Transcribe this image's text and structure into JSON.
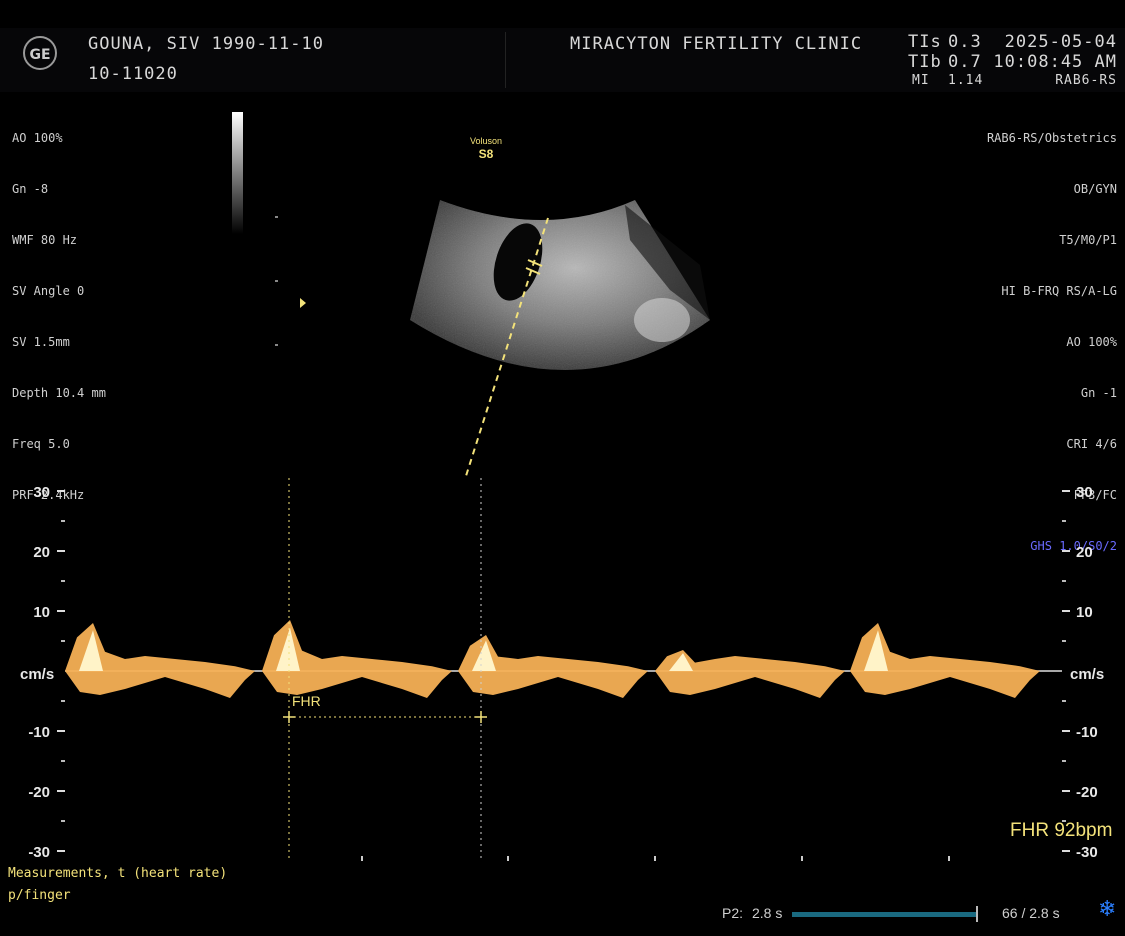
{
  "header": {
    "logo": "GE",
    "patient_name": "GOUNA, SIV  1990-11-10",
    "patient_id": "10-11020",
    "clinic": "MIRACYTON FERTILITY CLINIC",
    "ti1_label": "TIs",
    "ti1_value": "0.3",
    "ti2_label": "TIb",
    "ti2_value": "0.7",
    "mi_label": "MI",
    "mi_value": "1.14",
    "date": "2025-05-04",
    "time": "10:08:45 AM",
    "probe": "RAB6-RS"
  },
  "params_left": [
    "AO 100%",
    "Gn -8",
    "WMF 80 Hz",
    "SV Angle 0",
    "SV 1.5mm",
    "Depth 10.4 mm",
    "Freq 5.0",
    "PRF 2.4kHz"
  ],
  "params_right": [
    "RAB6-RS/Obstetrics",
    "OB/GYN",
    "T5/M0/P1",
    "HI B-FRQ RS/A-LG",
    "AO 100%",
    "Gn -1",
    "CRI 4/6",
    "FF3/FC"
  ],
  "params_right_highlight": "GHS 1.0/S0/2",
  "brand": {
    "line1": "Voluson",
    "line2": "S8"
  },
  "doppler": {
    "unit": "cm/s",
    "ticks": [
      30,
      20,
      10,
      -10,
      -20,
      -30
    ],
    "fhr_caliper_label": "FHR",
    "fhr_readout": "FHR 92bpm"
  },
  "footer": {
    "note_line1": "Measurements, t (heart rate)",
    "note_line2": "p/finger",
    "p2_label": "P2:",
    "p2_value": "2.8 s",
    "frame_counter": "66 / 2.8 s",
    "settings_icon": "snowflake-icon"
  },
  "chart_data": {
    "type": "area",
    "xlabel": "",
    "ylabel": "cm/s",
    "ylim": [
      -30,
      30
    ],
    "yticks": [
      30,
      20,
      10,
      -10,
      -20,
      -30
    ],
    "series": [
      {
        "name": "",
        "x": [
          0.0,
          0.3,
          0.6,
          1.0,
          1.4,
          1.6,
          2.0,
          2.3,
          2.6,
          2.8
        ],
        "values": [
          9,
          2,
          -5,
          9,
          1,
          -4,
          8,
          1,
          -4,
          3
        ]
      }
    ],
    "annotations": [
      "FHR",
      "FHR 92bpm"
    ]
  }
}
